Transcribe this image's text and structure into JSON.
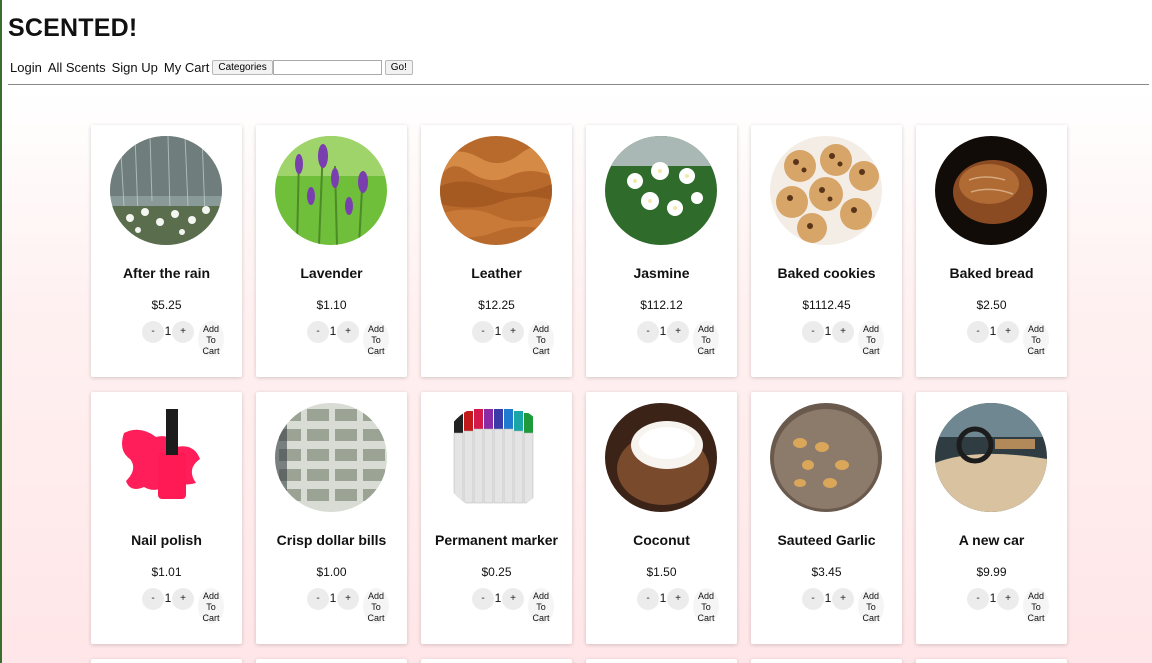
{
  "site": {
    "title": "SCENTED!"
  },
  "nav": {
    "links": [
      "Login",
      "All Scents",
      "Sign Up",
      "My Cart"
    ],
    "categories_label": "Categories",
    "search_value": "",
    "go_label": "Go!"
  },
  "cart_button": {
    "line1": "Add",
    "line2": "To",
    "line3": "Cart"
  },
  "products": [
    {
      "name": "After the rain",
      "price": "$5.25",
      "qty": "1",
      "icon": "rain-flowers-image"
    },
    {
      "name": "Lavender",
      "price": "$1.10",
      "qty": "1",
      "icon": "lavender-image"
    },
    {
      "name": "Leather",
      "price": "$12.25",
      "qty": "1",
      "icon": "leather-image"
    },
    {
      "name": "Jasmine",
      "price": "$112.12",
      "qty": "1",
      "icon": "jasmine-image"
    },
    {
      "name": "Baked cookies",
      "price": "$1112.45",
      "qty": "1",
      "icon": "cookies-image"
    },
    {
      "name": "Baked bread",
      "price": "$2.50",
      "qty": "1",
      "icon": "bread-image"
    },
    {
      "name": "Nail polish",
      "price": "$1.01",
      "qty": "1",
      "icon": "nail-polish-image"
    },
    {
      "name": "Crisp dollar bills",
      "price": "$1.00",
      "qty": "1",
      "icon": "dollar-bills-image"
    },
    {
      "name": "Permanent marker",
      "price": "$0.25",
      "qty": "1",
      "icon": "markers-image"
    },
    {
      "name": "Coconut",
      "price": "$1.50",
      "qty": "1",
      "icon": "coconut-image"
    },
    {
      "name": "Sauteed Garlic",
      "price": "$3.45",
      "qty": "1",
      "icon": "garlic-image"
    },
    {
      "name": "A new car",
      "price": "$9.99",
      "qty": "1",
      "icon": "car-interior-image"
    }
  ]
}
